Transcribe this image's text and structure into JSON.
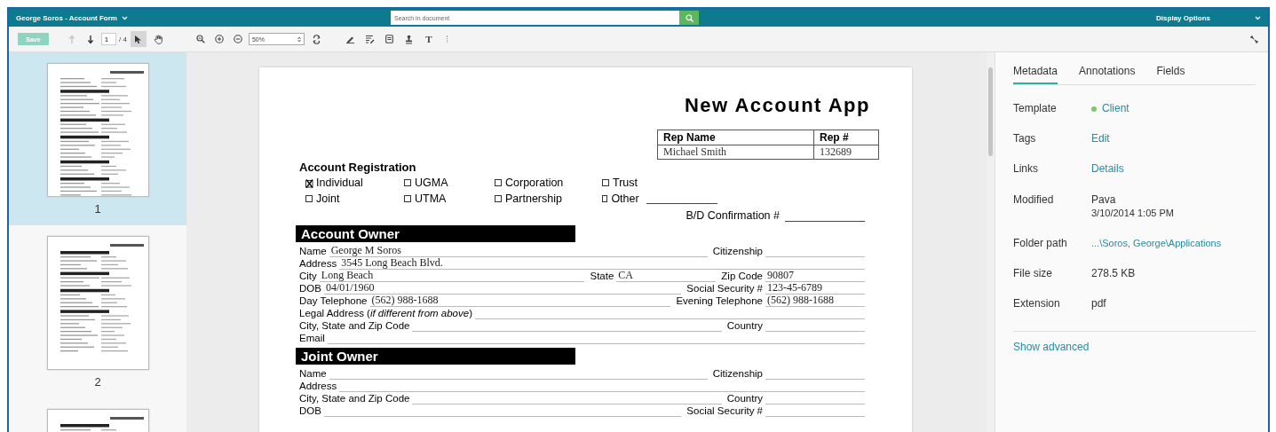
{
  "window": {
    "title": "George Soros - Account Form"
  },
  "search": {
    "placeholder": "Search in document"
  },
  "display_options": "Display Options",
  "toolbar": {
    "save": {
      "label": "Save",
      "disabled": true
    },
    "nav": [
      {
        "kind": "up",
        "disabled": true
      },
      {
        "kind": "down",
        "disabled": false
      }
    ],
    "page": "1",
    "page_total": "/ 4",
    "modes": [
      {
        "kind": "pointer",
        "selected": true
      },
      {
        "kind": "hand",
        "selected": false
      }
    ],
    "zoom": "50%",
    "annotate": [
      {
        "kind": "pen"
      },
      {
        "kind": "text-box"
      },
      {
        "kind": "note"
      },
      {
        "kind": "stamp"
      },
      {
        "kind": "text",
        "label": "T"
      }
    ]
  },
  "thumbnails": [
    {
      "label": "1",
      "selected": true
    },
    {
      "label": "2",
      "selected": false
    },
    {
      "selected": false
    }
  ],
  "document": {
    "title": "New Account App",
    "rep_table": {
      "columns": [
        "Rep Name",
        "Rep #"
      ],
      "row": [
        "Michael Smith",
        "132689"
      ]
    },
    "registration": {
      "heading": "Account Registration",
      "options": [
        {
          "label": "Individual",
          "checked": true
        },
        {
          "label": "UGMA",
          "checked": false
        },
        {
          "label": "Corporation",
          "checked": false
        },
        {
          "label": "Trust",
          "checked": false
        },
        {
          "label": "Joint",
          "checked": false
        },
        {
          "label": "UTMA",
          "checked": false
        },
        {
          "label": "Partnership",
          "checked": false
        },
        {
          "label": "Other",
          "checked": false
        }
      ]
    },
    "bd_confirmation": "B/D Confirmation #",
    "sections": [
      {
        "heading": "Account Owner",
        "rows": [
          [
            {
              "label": "Name",
              "value": "George M Soros"
            },
            {
              "label": "Citizenship"
            }
          ],
          [
            {
              "label": "Address",
              "value": "3545 Long Beach Blvd."
            }
          ],
          [
            {
              "label": "City",
              "value": "Long Beach"
            },
            {
              "label": "State",
              "value": "CA"
            },
            {
              "label": "Zip Code",
              "value": "90807"
            }
          ],
          [
            {
              "label": "DOB",
              "value": "04/01/1960"
            },
            {
              "label": "Social Security #",
              "value": "123-45-6789"
            }
          ],
          [
            {
              "label": "Day Telephone",
              "value": "(562) 988-1688"
            },
            {
              "label": "Evening Telephone",
              "value": "(562) 988-1688"
            }
          ],
          [
            {
              "label": "Legal Address (*if different from above*)"
            }
          ],
          [
            {
              "label": "City, State and Zip Code"
            },
            {
              "label": "Country"
            }
          ],
          [
            {
              "label": "Email"
            }
          ]
        ]
      },
      {
        "heading": "Joint Owner",
        "rows": [
          [
            {
              "label": "Name"
            },
            {
              "label": "Citizenship"
            }
          ],
          [
            {
              "label": "Address"
            }
          ],
          [
            {
              "label": "City, State and Zip Code"
            },
            {
              "label": "Country"
            }
          ],
          [
            {
              "label": "DOB"
            },
            {
              "label": "Social Security #"
            }
          ]
        ]
      }
    ]
  },
  "panel": {
    "tabs": [
      {
        "label": "Metadata",
        "selected": true
      },
      {
        "label": "Annotations",
        "selected": false
      },
      {
        "label": "Fields",
        "selected": false
      }
    ],
    "groups": [
      [
        {
          "label": "Template",
          "value": "Client",
          "kind": "status"
        },
        {
          "label": "Tags",
          "value": "Edit",
          "kind": "link"
        },
        {
          "label": "Links",
          "value": "Details",
          "kind": "link"
        }
      ],
      [
        {
          "label": "Modified",
          "value": "Pava",
          "detail": "3/10/2014 1:05 PM",
          "kind": "text"
        },
        {
          "label": "Folder path",
          "value": "...\\Soros, George\\Applications",
          "kind": "link"
        },
        {
          "label": "File size",
          "value": "278.5 KB",
          "kind": "text"
        },
        {
          "label": "Extension",
          "value": "pdf",
          "kind": "text"
        }
      ]
    ],
    "show_advanced": "Show advanced"
  }
}
